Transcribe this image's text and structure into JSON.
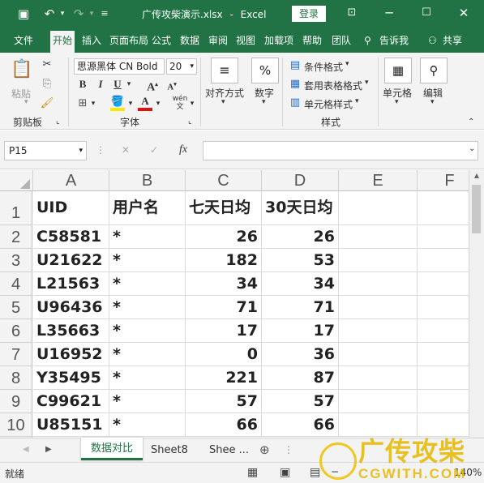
{
  "titlebar": {
    "file_name": "广传攻柴演示.xlsx",
    "separator": "-",
    "app_name": "Excel",
    "login_label": "登录"
  },
  "ribbon_tabs": [
    "文件",
    "开始",
    "插入",
    "页面布局",
    "公式",
    "数据",
    "审阅",
    "视图",
    "加载项",
    "帮助",
    "团队"
  ],
  "tell_me": "告诉我",
  "share": "共享",
  "clipboard": {
    "paste_label": "粘贴",
    "group_label": "剪贴板"
  },
  "font": {
    "family": "思源黑体 CN Bold",
    "size": "20",
    "group_label": "字体"
  },
  "alignment": {
    "label": "对齐方式"
  },
  "number": {
    "label": "数字"
  },
  "styles": {
    "conditional": "条件格式",
    "table_format": "套用表格格式",
    "cell_styles": "单元格样式",
    "group_label": "样式"
  },
  "cells": {
    "label": "单元格"
  },
  "editing": {
    "label": "编辑"
  },
  "formula_bar": {
    "name_box": "P15",
    "formula": "",
    "fx": "fx"
  },
  "columns": [
    "A",
    "B",
    "C",
    "D",
    "E",
    "F"
  ],
  "rows": [
    {
      "num": "1",
      "uid": "UID",
      "user": "用户名",
      "d7": "七天日均",
      "d30": "30天日均"
    },
    {
      "num": "2",
      "uid": "C58581",
      "user": "*",
      "d7": "26",
      "d30": "26"
    },
    {
      "num": "3",
      "uid": "U21622",
      "user": "*",
      "d7": "182",
      "d30": "53"
    },
    {
      "num": "4",
      "uid": "L21563",
      "user": "*",
      "d7": "34",
      "d30": "34"
    },
    {
      "num": "5",
      "uid": "U96436",
      "user": "*",
      "d7": "71",
      "d30": "71"
    },
    {
      "num": "6",
      "uid": "L35663",
      "user": "*",
      "d7": "17",
      "d30": "17"
    },
    {
      "num": "7",
      "uid": "U16952",
      "user": "*",
      "d7": "0",
      "d30": "36"
    },
    {
      "num": "8",
      "uid": "Y35495",
      "user": "*",
      "d7": "221",
      "d30": "87"
    },
    {
      "num": "9",
      "uid": "C99621",
      "user": "*",
      "d7": "57",
      "d30": "57"
    },
    {
      "num": "10",
      "uid": "U85151",
      "user": "*",
      "d7": "66",
      "d30": "66"
    }
  ],
  "sheet_tabs": [
    "数据对比",
    "Sheet8",
    "Shee ..."
  ],
  "status": {
    "ready": "就绪",
    "zoom": "140%"
  },
  "watermark": {
    "cn": "广传攻柴",
    "en": "CGWITH.COM"
  },
  "colors": {
    "excel_green": "#217346",
    "font_red": "#e01010",
    "highlight_yellow": "#ffe600"
  }
}
